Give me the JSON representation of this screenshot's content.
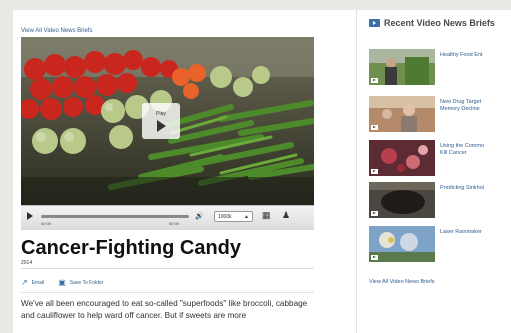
{
  "top_link": "View All Video News Briefs",
  "player": {
    "play_label": "Play",
    "time_elapsed": "00:00",
    "time_total": "00:00",
    "progress_fraction": 0.0,
    "quality": "1000k",
    "quality_arrow": "▲",
    "volume_icon": "speaker-icon",
    "fullscreen_icon": "fullscreen-icon"
  },
  "article": {
    "title": "Cancer-Fighting Candy",
    "year": "2014",
    "email_label": "Email",
    "save_label": "Save To Folder",
    "body": "We've all been encouraged to eat so-called \"superfoods\" like broccoli, cabbage and cauliflower to help ward off cancer. But if sweets are more"
  },
  "sidebar": {
    "heading": "Recent Video News Briefs",
    "items": [
      {
        "title": "Healthy Food Ent"
      },
      {
        "title": "New Drug Target\nMemory Decline"
      },
      {
        "title": "Using the Commo\nKill Cancer"
      },
      {
        "title": "Predicting Sinkhol"
      },
      {
        "title": "Laser Rainmaker"
      }
    ],
    "view_all": "View All Video News Briefs"
  }
}
